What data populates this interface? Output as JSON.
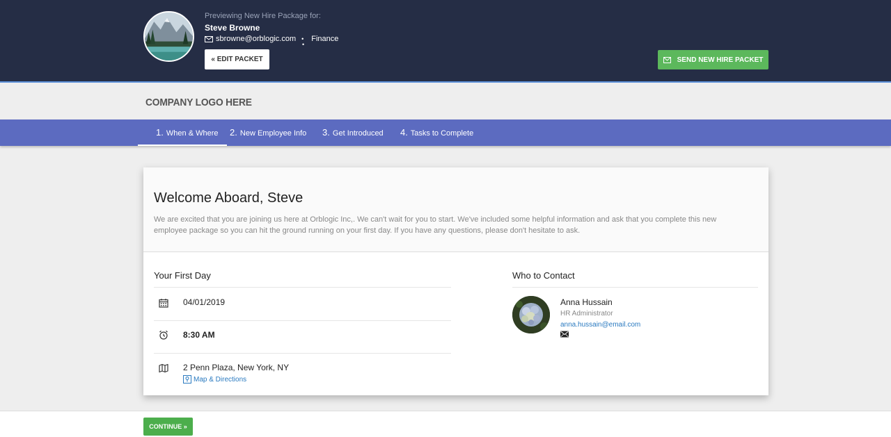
{
  "header": {
    "preview_label": "Previewing New Hire Package for:",
    "hire_name": "Steve Browne",
    "hire_email": "sbrowne@orblogic.com",
    "hire_department": "Finance",
    "edit_button": "« EDIT PACKET",
    "send_button": "SEND NEW HIRE PACKET",
    "send_color": "#5cb85c"
  },
  "company": {
    "logo_text": "COMPANY LOGO HERE"
  },
  "nav": {
    "color": "#5c6bc0",
    "tabs": [
      {
        "num": "1.",
        "label": "When & Where",
        "active": true
      },
      {
        "num": "2.",
        "label": "New Employee Info",
        "active": false
      },
      {
        "num": "3.",
        "label": "Get Introduced",
        "active": false
      },
      {
        "num": "4.",
        "label": "Tasks to Complete",
        "active": false
      }
    ]
  },
  "welcome": {
    "title": "Welcome Aboard, Steve",
    "text": "We are excited that you are joining us here at Orblogic Inc,. We can't wait for you to start. We've included some helpful information and ask that you complete this new employee package so you can hit the ground running on your first day. If you have any questions, please don't hesitate to ask."
  },
  "first_day": {
    "title": "Your First Day",
    "date": "04/01/2019",
    "time": "8:30 AM",
    "address": "2 Penn Plaza, New York, NY",
    "map_link": "Map & Directions"
  },
  "contact": {
    "title": "Who to Contact",
    "name": "Anna Hussain",
    "role": "HR Administrator",
    "email": "anna.hussain@email.com"
  },
  "footer": {
    "continue_button": "CONTINUE »",
    "continue_color": "#4cae4c"
  }
}
